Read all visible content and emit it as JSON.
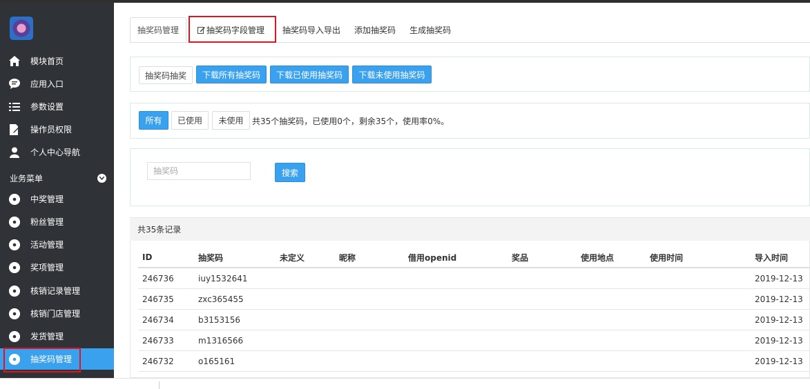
{
  "sidebar": {
    "items": [
      {
        "label": "模块首页",
        "icon": "home-icon"
      },
      {
        "label": "应用入口",
        "icon": "chat-bubble-icon"
      },
      {
        "label": "参数设置",
        "icon": "list-icon"
      },
      {
        "label": "操作员权限",
        "icon": "edit-document-icon"
      },
      {
        "label": "个人中心导航",
        "icon": "user-icon"
      }
    ],
    "section_title": "业务菜单",
    "business_items": [
      {
        "label": "中奖管理",
        "icon": "gear-icon"
      },
      {
        "label": "粉丝管理",
        "icon": "gear-icon"
      },
      {
        "label": "活动管理",
        "icon": "gear-icon"
      },
      {
        "label": "奖项管理",
        "icon": "gear-icon"
      },
      {
        "label": "核销记录管理",
        "icon": "gear-icon"
      },
      {
        "label": "核销门店管理",
        "icon": "gear-icon"
      },
      {
        "label": "发货管理",
        "icon": "gear-icon"
      },
      {
        "label": "抽奖码管理",
        "icon": "gear-icon",
        "active": true
      }
    ]
  },
  "tabs": [
    "抽奖码管理",
    "抽奖码字段管理",
    "抽奖码导入导出",
    "添加抽奖码",
    "生成抽奖码"
  ],
  "toolbar": {
    "lottery_btn": "抽奖码抽奖",
    "download_all": "下载所有抽奖码",
    "download_used": "下载已使用抽奖码",
    "download_unused": "下载未使用抽奖码"
  },
  "filter": {
    "all": "所有",
    "used": "已使用",
    "unused": "未使用",
    "stats": "共35个抽奖码，已使用0个，剩余35个，使用率0%。"
  },
  "search": {
    "placeholder": "抽奖码",
    "button": "搜索"
  },
  "list": {
    "count_text": "共35条记录",
    "columns": [
      "ID",
      "抽奖码",
      "未定义",
      "昵称",
      "借用openid",
      "奖品",
      "使用地点",
      "使用时间",
      "导入时间"
    ],
    "rows": [
      {
        "id": "246736",
        "code": "iuy1532641",
        "import_time": "2019-12-13"
      },
      {
        "id": "246735",
        "code": "zxc365455",
        "import_time": "2019-12-13"
      },
      {
        "id": "246734",
        "code": "b3153156",
        "import_time": "2019-12-13"
      },
      {
        "id": "246733",
        "code": "m1316566",
        "import_time": "2019-12-13"
      },
      {
        "id": "246732",
        "code": "o165161",
        "import_time": "2019-12-13"
      }
    ]
  },
  "colors": {
    "sidebar_bg": "#2f3337",
    "accent": "#3aa1ef",
    "highlight": "#e0141e"
  }
}
